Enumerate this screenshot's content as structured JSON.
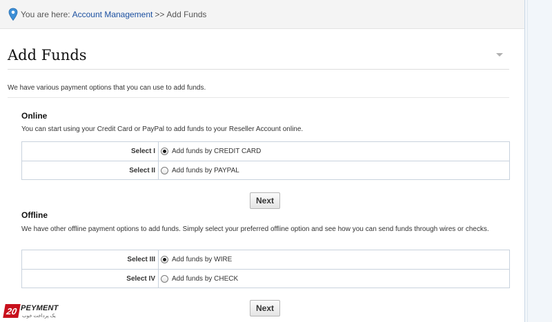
{
  "breadcrumb": {
    "lead": "You are here:",
    "link": "Account Management",
    "separator": ">>",
    "current": "Add Funds"
  },
  "page": {
    "title": "Add Funds",
    "intro": "We have various payment options that you can use to add funds."
  },
  "online": {
    "title": "Online",
    "description": "You can start using your Credit Card or PayPal to add funds to your Reseller Account online.",
    "options": [
      {
        "label": "Select I",
        "text": "Add funds by CREDIT CARD",
        "checked": true
      },
      {
        "label": "Select II",
        "text": "Add funds by PAYPAL",
        "checked": false
      }
    ],
    "next_label": "Next"
  },
  "offline": {
    "title": "Offline",
    "description": "We have other offline payment options to add funds. Simply select your preferred offline option and see how you can send funds through wires or checks.",
    "options": [
      {
        "label": "Select III",
        "text": "Add funds by WIRE",
        "checked": true
      },
      {
        "label": "Select IV",
        "text": "Add funds by CHECK",
        "checked": false
      }
    ],
    "next_label": "Next"
  },
  "logo": {
    "badge": "20",
    "name": "PEYMENT",
    "tagline": "یک پرداخت خوب"
  },
  "colors": {
    "link": "#1a4fa0",
    "pin": "#3d8fd6",
    "logo_red": "#c8101c"
  },
  "icons": {
    "breadcrumb_icon": "map-pin-icon",
    "collapse_icon": "collapse-triangle-icon"
  }
}
